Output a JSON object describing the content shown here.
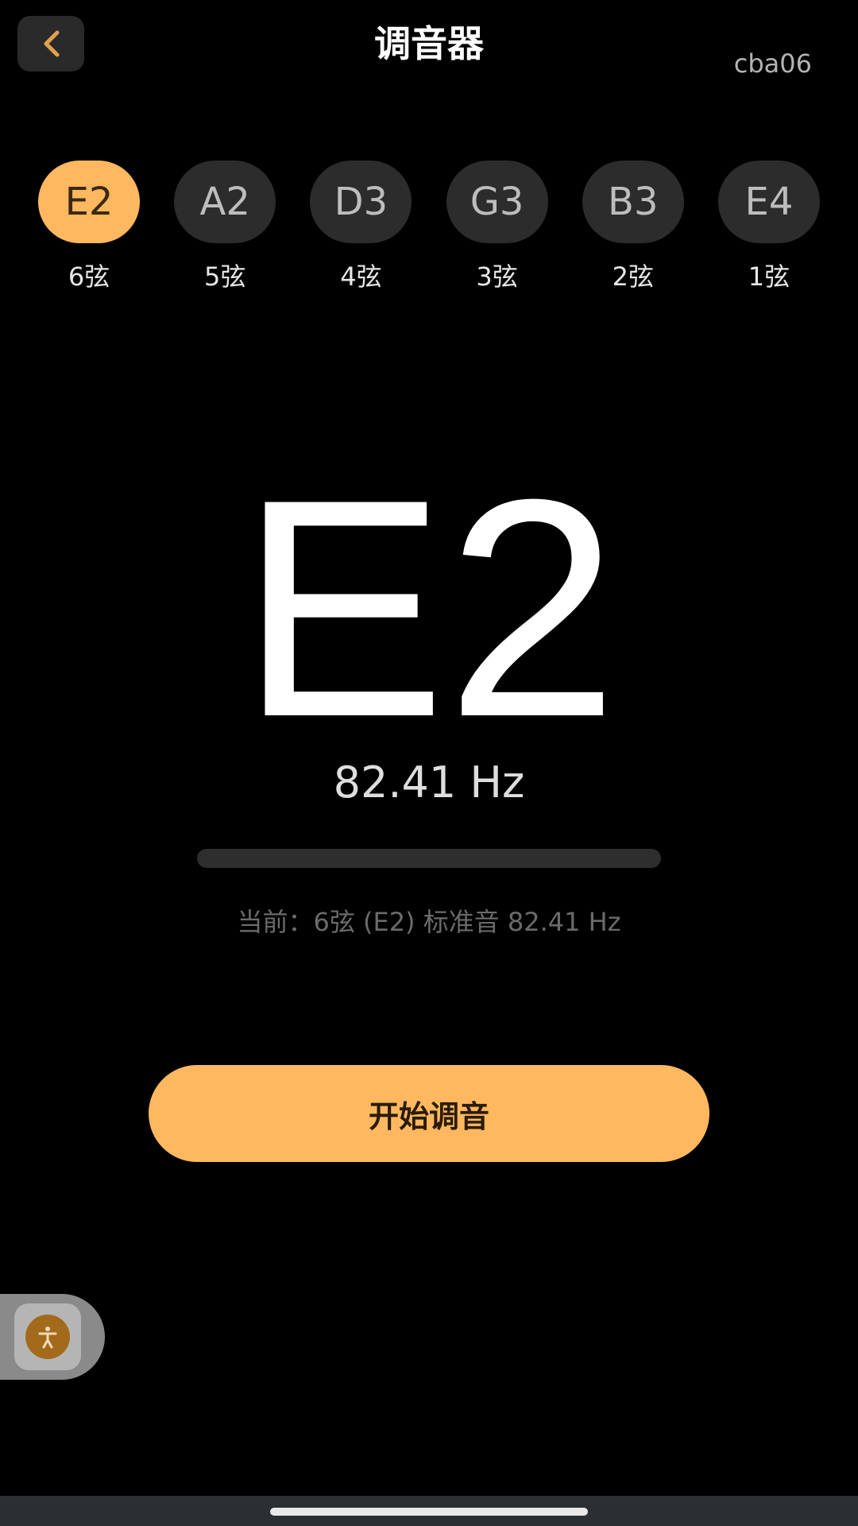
{
  "header": {
    "title": "调音器",
    "user_tag": "cba06",
    "back_icon": "chevron-left-icon"
  },
  "strings": [
    {
      "note": "E2",
      "label": "6弦",
      "selected": true
    },
    {
      "note": "A2",
      "label": "5弦",
      "selected": false
    },
    {
      "note": "D3",
      "label": "4弦",
      "selected": false
    },
    {
      "note": "G3",
      "label": "3弦",
      "selected": false
    },
    {
      "note": "B3",
      "label": "2弦",
      "selected": false
    },
    {
      "note": "E4",
      "label": "1弦",
      "selected": false
    }
  ],
  "display": {
    "note": "E2",
    "frequency": "82.41 Hz",
    "status": "当前：6弦 (E2) 标准音 82.41 Hz"
  },
  "actions": {
    "start_label": "开始调音"
  },
  "assistive_touch": {
    "icon": "accessibility-person-icon"
  },
  "colors": {
    "accent": "#ffb860",
    "background": "#000000",
    "pill_inactive": "#2c2c2c"
  }
}
